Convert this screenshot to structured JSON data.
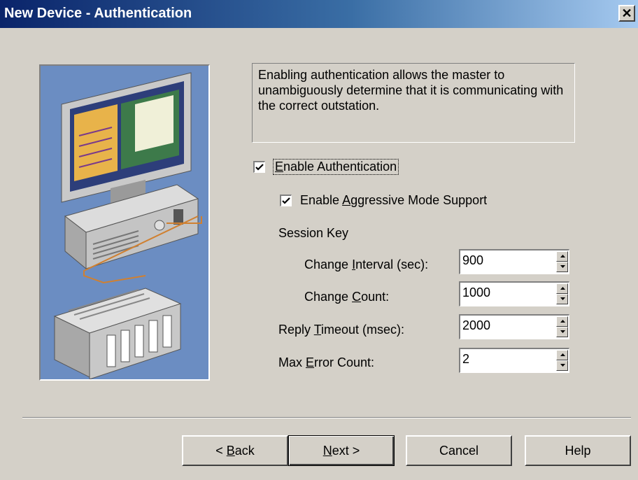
{
  "window": {
    "title": "New Device - Authentication",
    "close_glyph": "✕"
  },
  "description": "Enabling authentication allows the master to unambiguously determine that it is communicating with the correct outstation.",
  "enable_authentication": {
    "label_prefix": "",
    "label_mnemonic": "E",
    "label_rest": "nable Authentication",
    "checked": true
  },
  "enable_aggressive": {
    "label_prefix": "Enable ",
    "label_mnemonic": "A",
    "label_rest": "ggressive Mode Support",
    "checked": true
  },
  "session_key_label": "Session Key",
  "fields": {
    "change_interval": {
      "label_prefix": "Change ",
      "label_mnemonic": "I",
      "label_rest": "nterval (sec):",
      "value": "900"
    },
    "change_count": {
      "label_prefix": "Change ",
      "label_mnemonic": "C",
      "label_rest": "ount:",
      "value": "1000"
    },
    "reply_timeout": {
      "label_prefix": "Reply ",
      "label_mnemonic": "T",
      "label_rest": "imeout (msec):",
      "value": "2000"
    },
    "max_error_count": {
      "label_prefix": "Max ",
      "label_mnemonic": "E",
      "label_rest": "rror Count:",
      "value": "2"
    }
  },
  "buttons": {
    "back": {
      "prefix": "< ",
      "mnemonic": "B",
      "rest": "ack"
    },
    "next": {
      "prefix": "",
      "mnemonic": "N",
      "rest": "ext >"
    },
    "cancel": "Cancel",
    "help": "Help"
  },
  "icons": {
    "close": "close-icon",
    "check": "checkmark-icon",
    "spin_up": "spin-up-arrow-icon",
    "spin_down": "spin-down-arrow-icon",
    "illustration": "computer-plc-illustration"
  }
}
